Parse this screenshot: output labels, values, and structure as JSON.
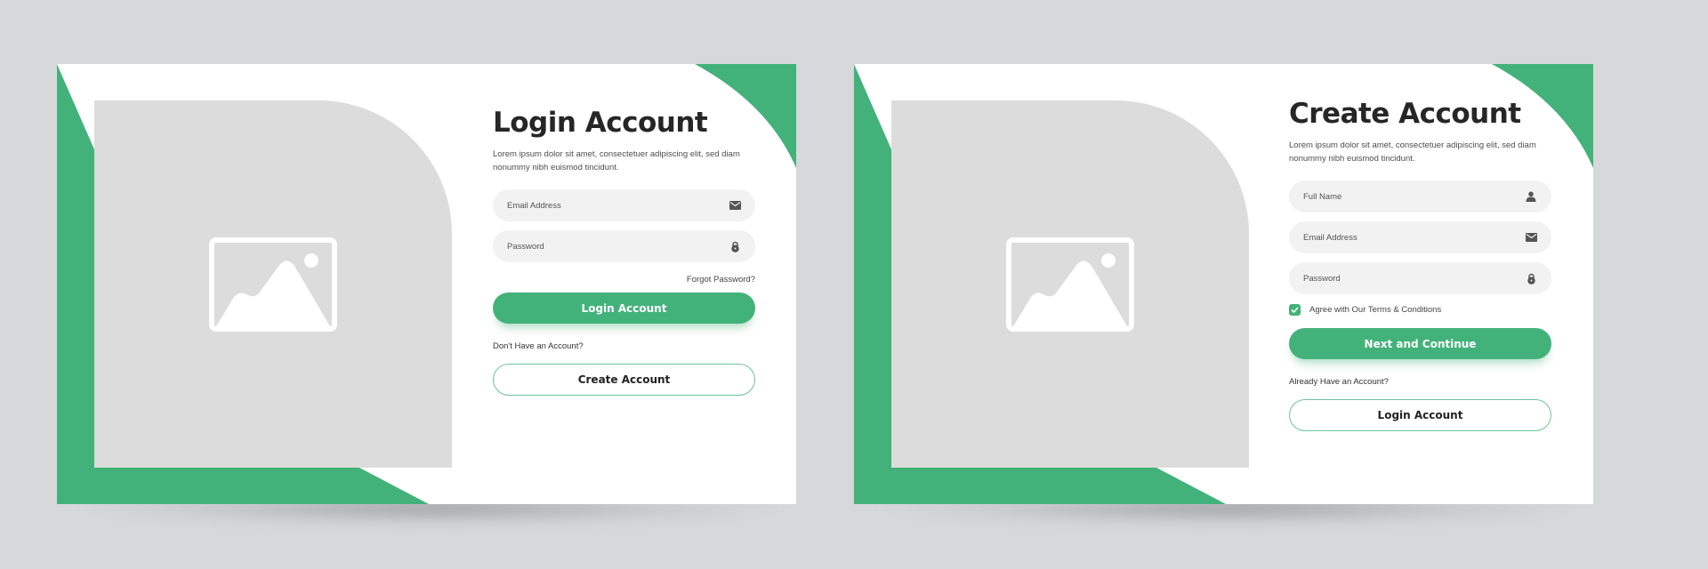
{
  "theme": {
    "accent": "#43b27a",
    "background": "#d6d8db",
    "placeholder": "#dcdcdc"
  },
  "login_card": {
    "image_placeholder_icon": "image-icon",
    "title": "Login Account",
    "description": "Lorem ipsum dolor sit amet, consectetuer adipiscing elit, sed diam nonummy nibh euismod tincidunt.",
    "fields": [
      {
        "placeholder": "Email Address",
        "icon": "envelope-icon"
      },
      {
        "placeholder": "Password",
        "icon": "lock-icon"
      }
    ],
    "forgot_password": "Forgot Password?",
    "primary_button": "Login Account",
    "secondary_prompt": "Don't Have an Account?",
    "secondary_button": "Create Account"
  },
  "signup_card": {
    "image_placeholder_icon": "image-icon",
    "title": "Create Account",
    "description": "Lorem ipsum dolor sit amet, consectetuer adipiscing elit, sed diam nonummy nibh euismod tincidunt.",
    "fields": [
      {
        "placeholder": "Full Name",
        "icon": "user-icon"
      },
      {
        "placeholder": "Email Address",
        "icon": "envelope-icon"
      },
      {
        "placeholder": "Password",
        "icon": "lock-icon"
      }
    ],
    "terms_checkbox": {
      "label": "Agree with Our Terms & Conditions",
      "checked": true
    },
    "primary_button": "Next and Continue",
    "secondary_prompt": "Already Have an Account?",
    "secondary_button": "Login Account"
  }
}
